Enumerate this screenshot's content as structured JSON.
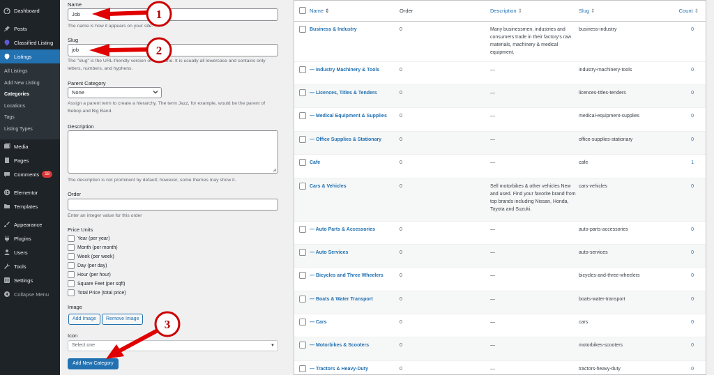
{
  "sidebar": {
    "dashboard": "Dashboard",
    "posts": "Posts",
    "classified": "Classified Listing",
    "listings": "Listings",
    "sub": [
      "All Listings",
      "Add New Listing",
      "Categories",
      "Locations",
      "Tags",
      "Listing Types"
    ],
    "media": "Media",
    "pages": "Pages",
    "comments": "Comments",
    "comments_count": "18",
    "elementor": "Elementor",
    "templates": "Templates",
    "appearance": "Appearance",
    "plugins": "Plugins",
    "users": "Users",
    "tools": "Tools",
    "settings": "Settings",
    "collapse": "Collapse Menu"
  },
  "form": {
    "name_label": "Name",
    "name_value": "Job",
    "name_help": "The name is how it appears on your site.",
    "slug_label": "Slug",
    "slug_value": "job",
    "slug_help": "The \"slug\" is the URL-friendly version of the name. It is usually all lowercase and contains only letters, numbers, and hyphens.",
    "parent_label": "Parent Category",
    "parent_value": "None",
    "parent_help": "Assign a parent term to create a hierarchy. The term Jazz, for example, would be the parent of Bebop and Big Band.",
    "description_label": "Description",
    "description_help": "The description is not prominent by default; however, some themes may show it.",
    "order_label": "Order",
    "order_help": "Enter an integer value for this order",
    "price_units_label": "Price Units",
    "price_units": [
      "Year (per year)",
      "Month (per month)",
      "Week (per week)",
      "Day (per day)",
      "Hour (per hour)",
      "Square Feet (per sqft)",
      "Total Price (total price)"
    ],
    "image_label": "Image",
    "add_image": "Add Image",
    "remove_image": "Remove Image",
    "icon_label": "Icon",
    "icon_placeholder": "Select one",
    "submit": "Add New Category"
  },
  "table": {
    "headers": {
      "name": "Name",
      "order": "Order",
      "description": "Description",
      "slug": "Slug",
      "count": "Count"
    },
    "rows": [
      {
        "name": "Business & Industry",
        "order": "0",
        "description": "Many businessmen, industries and consumers trade in their factory's raw materials, machinery & medical equipment.",
        "slug": "business-industry",
        "count": "0"
      },
      {
        "name": "— Industry Machinery & Tools",
        "order": "0",
        "description": "—",
        "slug": "industry-machinery-tools",
        "count": "0"
      },
      {
        "name": "— Licences, Titles & Tenders",
        "order": "0",
        "description": "—",
        "slug": "licences-titles-tenders",
        "count": "0"
      },
      {
        "name": "— Medical Equipment & Supplies",
        "order": "0",
        "description": "—",
        "slug": "medical-equipment-supplies",
        "count": "0"
      },
      {
        "name": "— Office Supplies & Stationary",
        "order": "0",
        "description": "—",
        "slug": "office-supplies-stationary",
        "count": "0"
      },
      {
        "name": "Cafe",
        "order": "0",
        "description": "—",
        "slug": "cafe",
        "count": "1"
      },
      {
        "name": "Cars & Vehicles",
        "order": "0",
        "description": "Sell motorbikes & other vehicles New and used. Find your favorite brand from top brands including Nissan, Honda, Toyota and Suzuki.",
        "slug": "cars-vehicles",
        "count": "0"
      },
      {
        "name": "— Auto Parts & Accessories",
        "order": "0",
        "description": "—",
        "slug": "auto-parts-accessories",
        "count": "0"
      },
      {
        "name": "— Auto Services",
        "order": "0",
        "description": "—",
        "slug": "auto-services",
        "count": "0"
      },
      {
        "name": "— Bicycles and Three Wheelers",
        "order": "0",
        "description": "—",
        "slug": "bicycles-and-three-wheelers",
        "count": "0"
      },
      {
        "name": "— Boats & Water Transport",
        "order": "0",
        "description": "—",
        "slug": "boats-water-transport",
        "count": "0"
      },
      {
        "name": "— Cars",
        "order": "0",
        "description": "—",
        "slug": "cars",
        "count": "0"
      },
      {
        "name": "— Motorbikes & Scooters",
        "order": "0",
        "description": "—",
        "slug": "motorbikes-scooters",
        "count": "0"
      },
      {
        "name": "— Tractors & Heavy-Duty",
        "order": "0",
        "description": "—",
        "slug": "tractors-heavy-duty",
        "count": "0"
      }
    ]
  },
  "annotations": [
    "1",
    "2",
    "3"
  ],
  "colors": {
    "accent": "#2271b1",
    "sidebar": "#1d2327",
    "annotation": "#d40000"
  }
}
